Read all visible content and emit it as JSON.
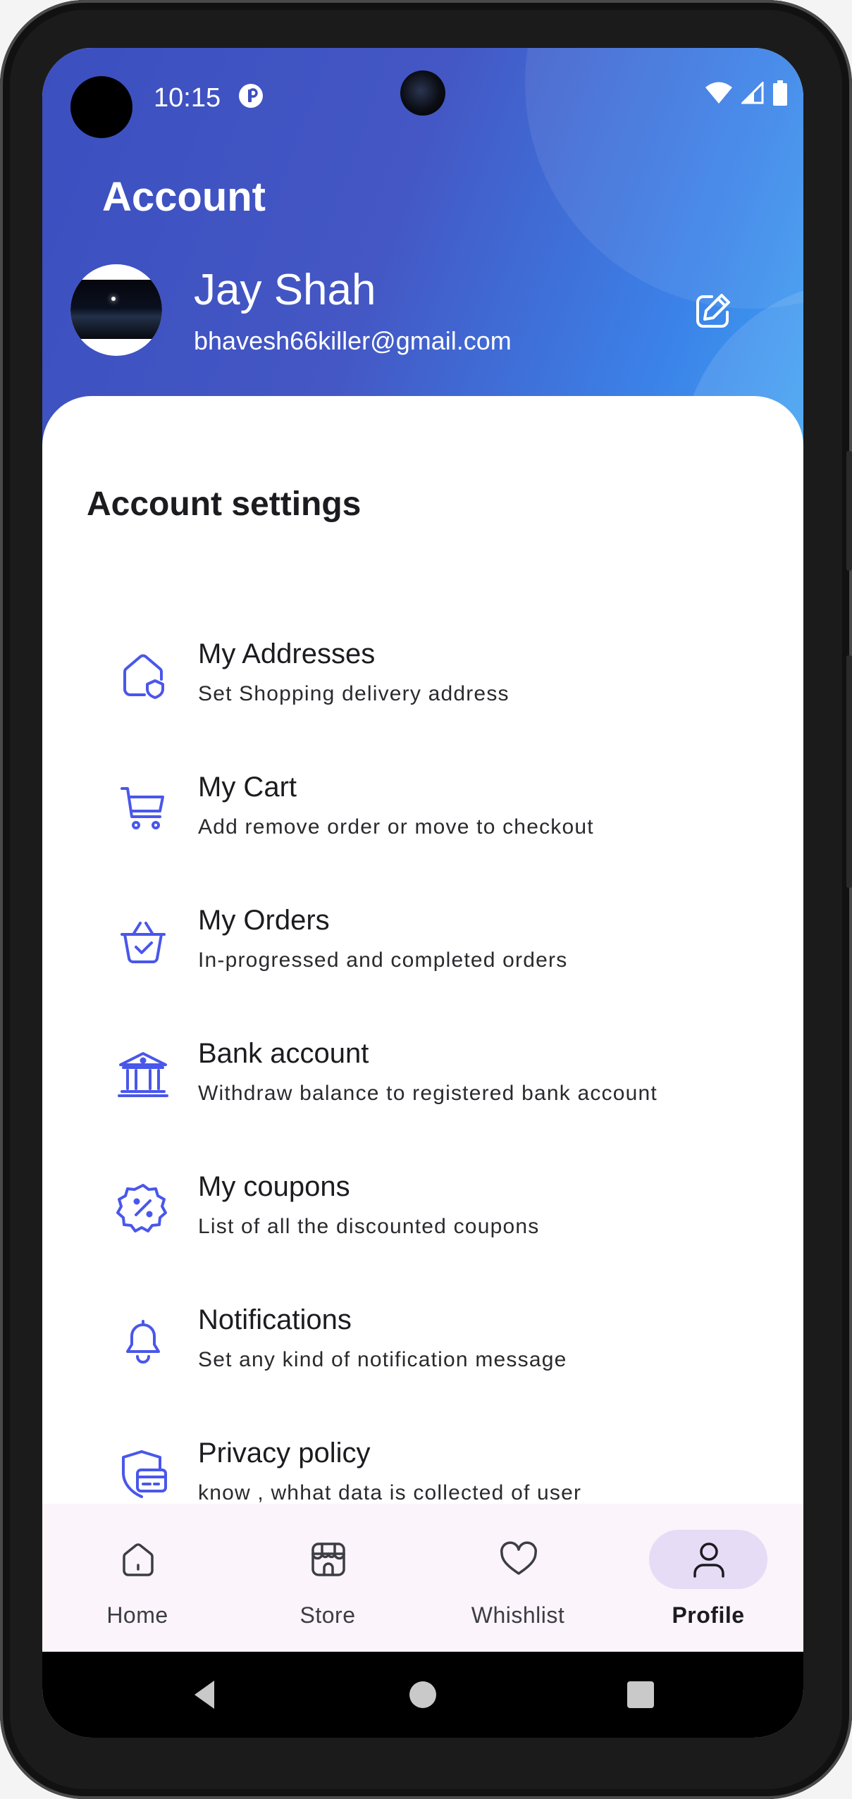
{
  "colors": {
    "accent": "#4957ea",
    "header_start": "#3b4fc0",
    "header_end": "#3ea2f3",
    "nav_active_pill": "#e6dcf6",
    "bottom_nav_bg": "#fbf4fb"
  },
  "status_bar": {
    "time": "10:15",
    "icons": [
      "app-notification-icon",
      "wifi-icon",
      "cellular-signal-icon",
      "battery-icon"
    ]
  },
  "header": {
    "title": "Account",
    "user": {
      "name": "Jay Shah",
      "email": "bhavesh66killer@gmail.com"
    },
    "edit_icon": "edit-icon"
  },
  "settings": {
    "title": "Account settings",
    "items": [
      {
        "title": "My Addresses",
        "subtitle": "Set Shopping delivery address",
        "icon": "home-shield-icon"
      },
      {
        "title": "My Cart",
        "subtitle": "Add remove order or move to checkout",
        "icon": "cart-icon"
      },
      {
        "title": "My Orders",
        "subtitle": "In-progressed and completed orders",
        "icon": "basket-check-icon"
      },
      {
        "title": "Bank account",
        "subtitle": "Withdraw balance to registered bank account",
        "icon": "bank-icon"
      },
      {
        "title": "My coupons",
        "subtitle": "List of all the discounted coupons",
        "icon": "discount-badge-icon"
      },
      {
        "title": "Notifications",
        "subtitle": "Set any kind of notification message",
        "icon": "bell-icon"
      },
      {
        "title": "Privacy policy",
        "subtitle": "know , whhat data is collected of user",
        "icon": "security-card-icon"
      }
    ]
  },
  "bottom_nav": {
    "items": [
      {
        "label": "Home",
        "icon": "home-icon",
        "active": false
      },
      {
        "label": "Store",
        "icon": "store-icon",
        "active": false
      },
      {
        "label": "Whishlist",
        "icon": "heart-icon",
        "active": false
      },
      {
        "label": "Profile",
        "icon": "user-icon",
        "active": true
      }
    ]
  },
  "system_nav": [
    "back-icon",
    "home-circle-icon",
    "recents-icon"
  ]
}
